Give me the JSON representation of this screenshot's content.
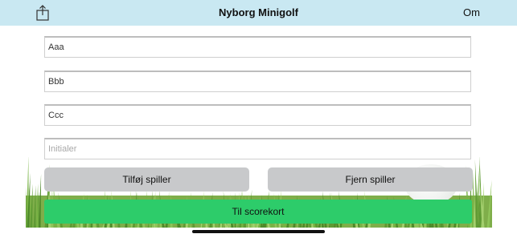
{
  "navbar": {
    "title": "Nyborg Minigolf",
    "right_label": "Om",
    "left_icon": "share-icon",
    "background": "#c9e8f2"
  },
  "players": {
    "inputs": [
      {
        "value": "Aaa",
        "placeholder": ""
      },
      {
        "value": "Bbb",
        "placeholder": ""
      },
      {
        "value": "Ccc",
        "placeholder": ""
      },
      {
        "value": "",
        "placeholder": "Initialer"
      }
    ]
  },
  "actions": {
    "add_label": "Tilføj spiller",
    "remove_label": "Fjern spiller",
    "scorecard_label": "Til scorekort",
    "primary_color": "#2dcc6a",
    "secondary_color": "#c8c9cb"
  }
}
